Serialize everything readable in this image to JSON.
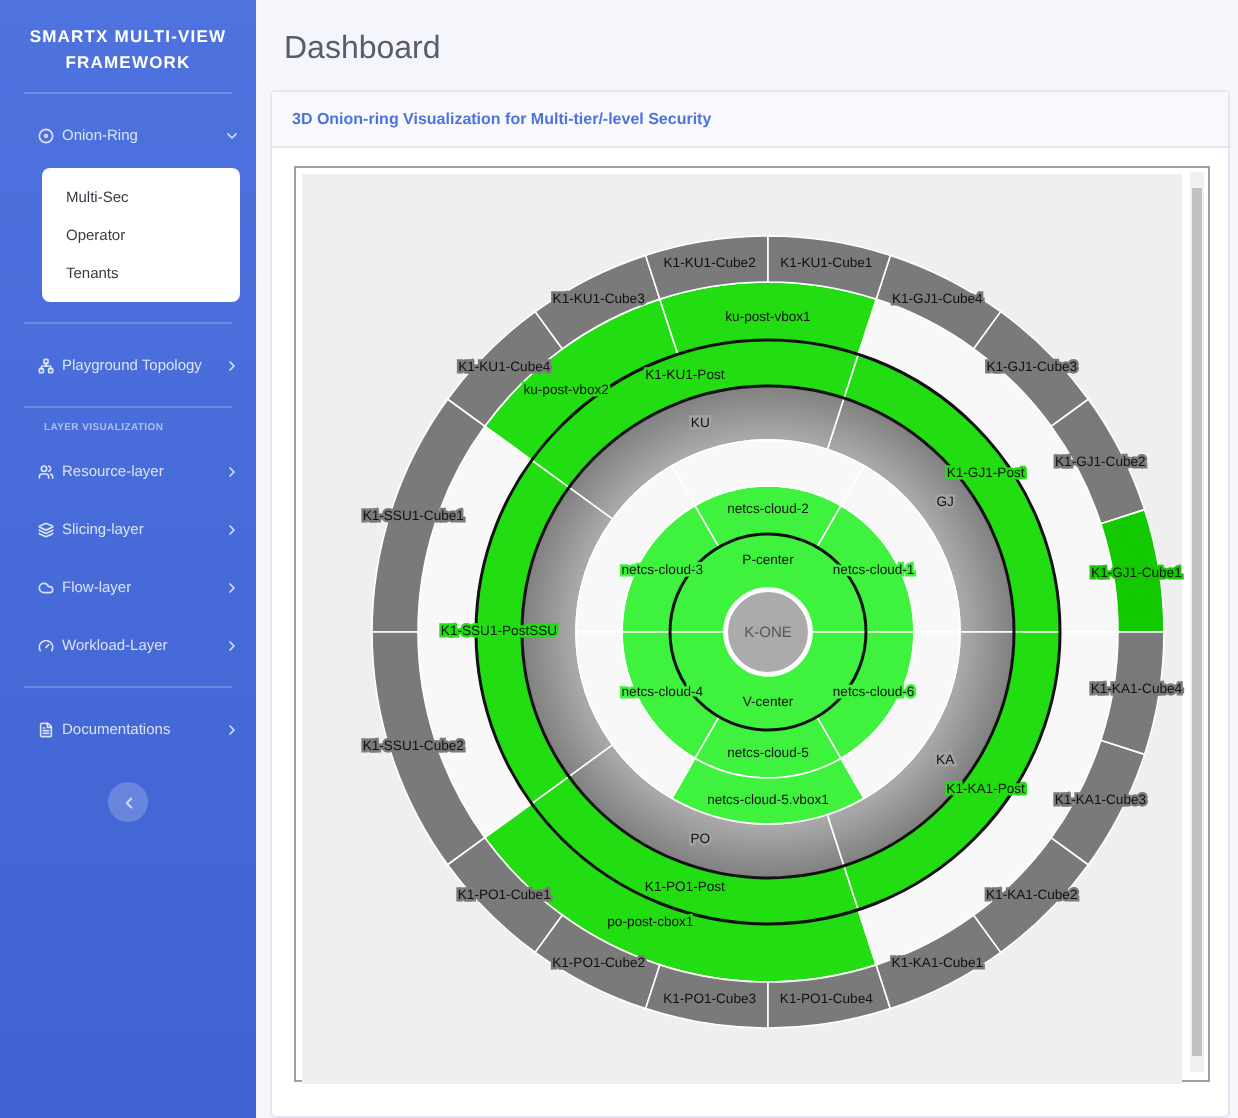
{
  "sidebar": {
    "title": "SMARTX MULTI-VIEW FRAMEWORK",
    "groups": [
      {
        "items": [
          {
            "label": "Onion-Ring",
            "expanded": true,
            "children": [
              {
                "label": "Multi-Sec"
              },
              {
                "label": "Operator"
              },
              {
                "label": "Tenants"
              }
            ]
          }
        ]
      },
      {
        "items": [
          {
            "label": "Playground Topology",
            "expanded": false
          }
        ]
      },
      {
        "heading": "LAYER VISUALIZATION",
        "items": [
          {
            "label": "Resource-layer",
            "expanded": false
          },
          {
            "label": "Slicing-layer",
            "expanded": false
          },
          {
            "label": "Flow-layer",
            "expanded": false
          },
          {
            "label": "Workload-Layer",
            "expanded": false
          }
        ]
      },
      {
        "items": [
          {
            "label": "Documentations",
            "expanded": false
          }
        ]
      }
    ]
  },
  "header": {
    "title": "Dashboard"
  },
  "card": {
    "title": "3D Onion-ring Visualization for Multi-tier/-level Security",
    "onion": {
      "core": "K-ONE",
      "inner": [
        {
          "label": "P-center",
          "kind": "green",
          "children": [
            {
              "label": "netcs-cloud-3",
              "kind": "green",
              "children": [
                {
                  "kind": "gap"
                }
              ]
            },
            {
              "label": "netcs-cloud-2",
              "kind": "green",
              "children": [
                {
                  "kind": "gap"
                }
              ]
            },
            {
              "label": "netcs-cloud-1",
              "kind": "green",
              "children": [
                {
                  "kind": "gap"
                }
              ]
            }
          ]
        },
        {
          "label": "V-center",
          "kind": "green",
          "children": [
            {
              "label": "netcs-cloud-4",
              "kind": "green",
              "children": [
                {
                  "kind": "gap"
                }
              ]
            },
            {
              "label": "netcs-cloud-5",
              "kind": "green",
              "children": [
                {
                  "label": "netcs-cloud-5.vbox1",
                  "kind": "green"
                }
              ]
            },
            {
              "label": "netcs-cloud-6",
              "kind": "green",
              "children": [
                {
                  "kind": "gap"
                }
              ]
            }
          ]
        }
      ],
      "outer": [
        {
          "label": "GJ",
          "kind": "grey",
          "children": [
            {
              "label": "K1-GJ1-Post",
              "kind": "green",
              "children": [
                {
                  "kind": "gap",
                  "children": [
                    {
                      "label": "K1-GJ1-Cube4",
                      "kind": "grey"
                    },
                    {
                      "label": "K1-GJ1-Cube3",
                      "kind": "grey"
                    },
                    {
                      "label": "K1-GJ1-Cube2",
                      "kind": "grey"
                    },
                    {
                      "label": "K1-GJ1-Cube1",
                      "kind": "green"
                    }
                  ]
                }
              ]
            }
          ]
        },
        {
          "label": "KU",
          "kind": "grey",
          "children": [
            {
              "label": "K1-KU1-Post",
              "kind": "green",
              "children": [
                {
                  "label": "ku-post-vbox2",
                  "kind": "green",
                  "children": [
                    {
                      "label": "K1-KU1-Cube4",
                      "kind": "grey"
                    },
                    {
                      "label": "K1-KU1-Cube3",
                      "kind": "grey"
                    }
                  ]
                },
                {
                  "label": "ku-post-vbox1",
                  "kind": "green",
                  "children": [
                    {
                      "label": "K1-KU1-Cube2",
                      "kind": "grey"
                    },
                    {
                      "label": "K1-KU1-Cube1",
                      "kind": "grey"
                    }
                  ]
                }
              ]
            }
          ]
        },
        {
          "kind": "grey",
          "children": [
            {
              "label": "K1-SSU1-PostSSU",
              "kind": "green",
              "children": [
                {
                  "kind": "gap",
                  "children": [
                    {
                      "label": "K1-SSU1-Cube1",
                      "kind": "grey"
                    },
                    {
                      "label": "K1-SSU1-Cube2",
                      "kind": "grey"
                    }
                  ]
                }
              ]
            }
          ]
        },
        {
          "label": "PO",
          "kind": "grey",
          "children": [
            {
              "label": "K1-PO1-Post",
              "kind": "green",
              "children": [
                {
                  "label": "po-post-cbox1",
                  "kind": "green",
                  "children": [
                    {
                      "label": "K1-PO1-Cube1",
                      "kind": "grey"
                    },
                    {
                      "label": "K1-PO1-Cube2",
                      "kind": "grey"
                    },
                    {
                      "label": "K1-PO1-Cube3",
                      "kind": "grey"
                    },
                    {
                      "label": "K1-PO1-Cube4",
                      "kind": "grey"
                    }
                  ]
                }
              ]
            }
          ]
        },
        {
          "label": "KA",
          "kind": "grey",
          "children": [
            {
              "label": "K1-KA1-Post",
              "kind": "green",
              "children": [
                {
                  "kind": "gap",
                  "children": [
                    {
                      "label": "K1-KA1-Cube1",
                      "kind": "grey"
                    },
                    {
                      "label": "K1-KA1-Cube2",
                      "kind": "grey"
                    },
                    {
                      "label": "K1-KA1-Cube3",
                      "kind": "grey"
                    },
                    {
                      "label": "K1-KA1-Cube4",
                      "kind": "grey"
                    }
                  ]
                }
              ]
            }
          ]
        }
      ]
    }
  }
}
